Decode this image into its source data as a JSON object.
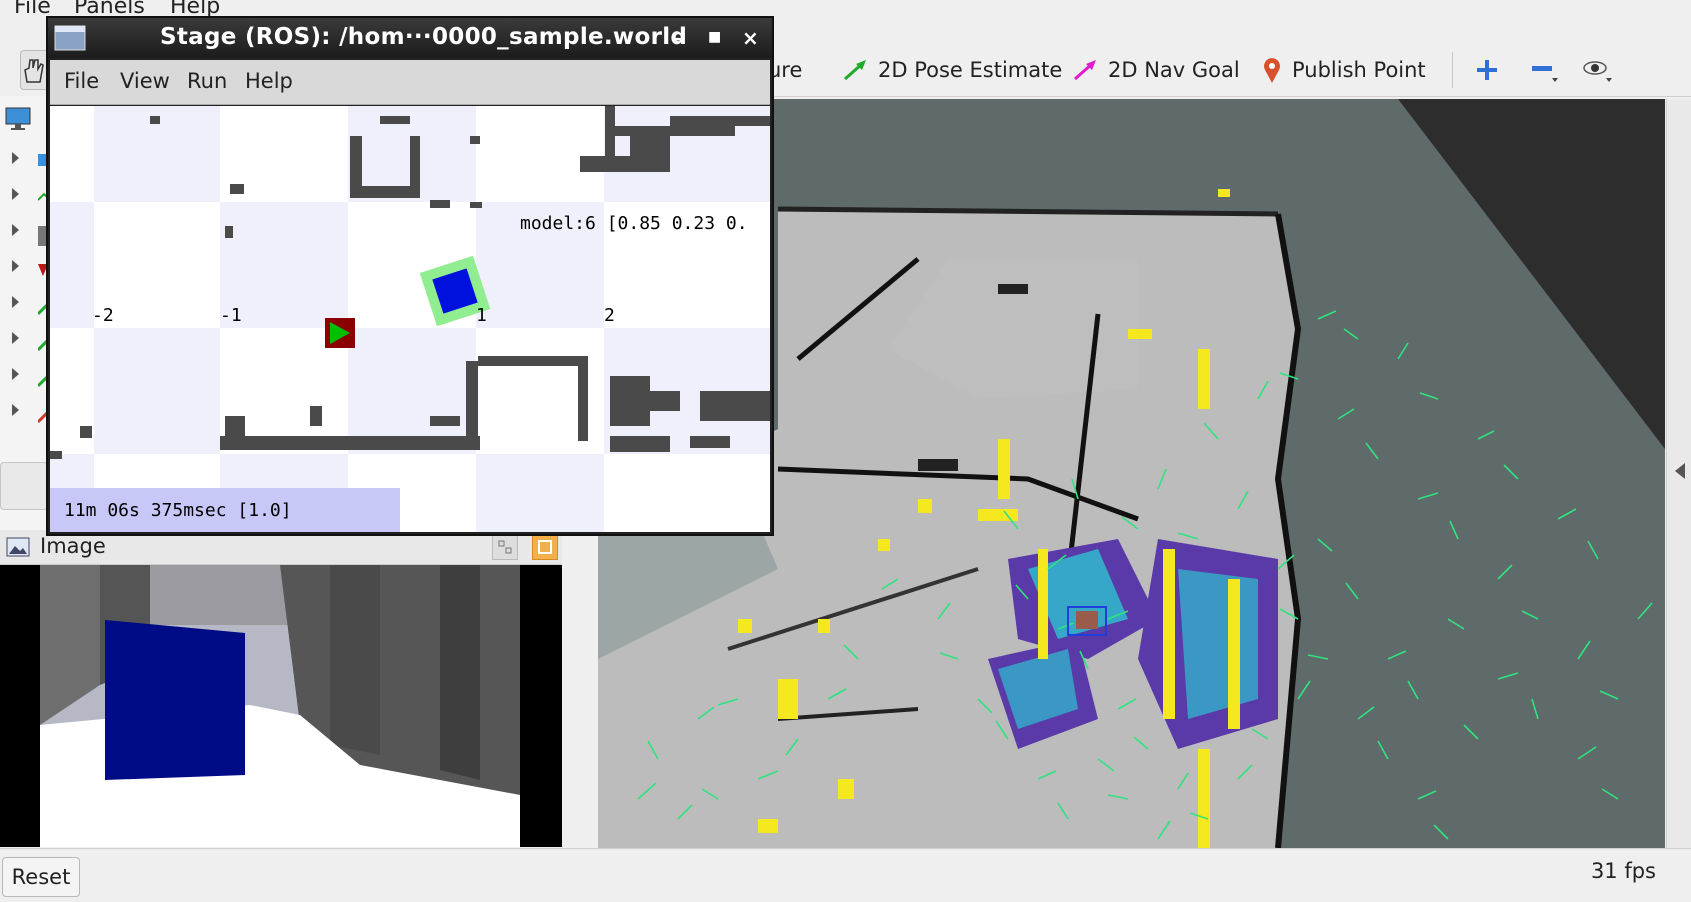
{
  "rviz": {
    "menu": [
      "File",
      "Panels",
      "Help"
    ],
    "toolbar": {
      "partial_label": "ure",
      "pose_estimate": "2D Pose Estimate",
      "nav_goal": "2D Nav Goal",
      "publish_point": "Publish Point"
    },
    "image_panel_title": "Image",
    "reset_label": "Reset",
    "fps": "31 fps"
  },
  "stage": {
    "title": "Stage (ROS): /hom···0000_sample.world",
    "menu": [
      "File",
      "View",
      "Run",
      "Help"
    ],
    "axis_ticks": [
      "-2",
      "-1",
      "1",
      "2"
    ],
    "model_label": "model:6 [0.85 0.23 0.",
    "clock": "11m 06s 375msec [1.0]"
  },
  "colors": {
    "viewport_bg": "#5f6a6a",
    "map_gray": "#bcbcbc",
    "particles": "#2fe37f",
    "costmap_yellow": "#f6e81e",
    "costmap_purple": "#5a3aa8",
    "costmap_cyan": "#27d6d6",
    "stage_footer": "#c8c8f8",
    "robot_box": "#0a16c8"
  }
}
